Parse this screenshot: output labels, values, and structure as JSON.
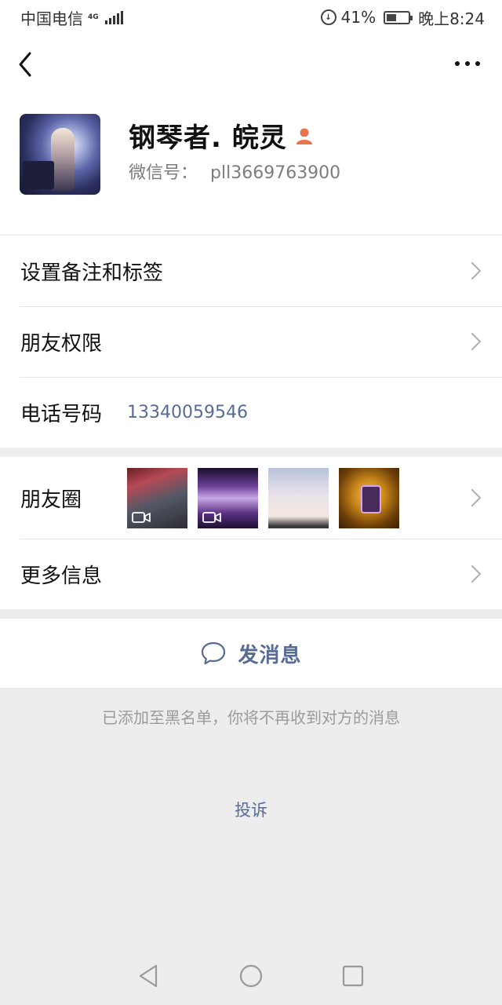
{
  "status_bar": {
    "carrier": "中国电信",
    "network": "4G",
    "battery_percent": "41%",
    "time": "晚上8:24"
  },
  "nav": {
    "back_icon": "chevron-left-icon",
    "more_icon": "more-dots-icon"
  },
  "profile": {
    "nickname": "钢琴者. 皖灵",
    "gender_icon": "female-user-icon",
    "wechat_id_label": "微信号：",
    "wechat_id_value": "pll3669763900"
  },
  "menu_top": {
    "remark_label": "设置备注和标签",
    "permission_label": "朋友权限",
    "phone_label": "电话号码",
    "phone_value": "13340059546"
  },
  "menu_bottom": {
    "moments_label": "朋友圈",
    "more_info_label": "更多信息"
  },
  "actions": {
    "send_message_label": "发消息",
    "blacklist_note": "已添加至黑名单，你将不再收到对方的消息",
    "complain_label": "投诉"
  },
  "colors": {
    "link": "#576b95",
    "background": "#ededed",
    "gender_icon": "#e8734c"
  }
}
